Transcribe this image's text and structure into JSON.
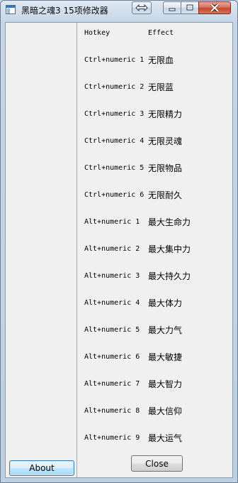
{
  "window": {
    "title": "黑暗之魂3 15项修改器",
    "caption_buttons": {
      "swap_icon": "swap-arrows-icon",
      "minimize_icon": "minimize-icon",
      "maximize_icon": "maximize-icon",
      "close_icon": "close-x-icon",
      "close_color": "#c3472f"
    }
  },
  "sidebar": {
    "about_label": "About"
  },
  "hotkeys": {
    "header": {
      "hotkey": "Hotkey",
      "effect": "Effect"
    },
    "rows": [
      {
        "hotkey": "Ctrl+numeric 1",
        "effect": "无限血"
      },
      {
        "hotkey": "Ctrl+numeric 2",
        "effect": "无限蓝"
      },
      {
        "hotkey": "Ctrl+numeric 3",
        "effect": "无限精力"
      },
      {
        "hotkey": "Ctrl+numeric 4",
        "effect": "无限灵魂"
      },
      {
        "hotkey": "Ctrl+numeric 5",
        "effect": "无限物品"
      },
      {
        "hotkey": "Ctrl+numeric 6",
        "effect": "无限耐久"
      },
      {
        "hotkey": "Alt+numeric 1",
        "effect": "最大生命力"
      },
      {
        "hotkey": "Alt+numeric 2",
        "effect": "最大集中力"
      },
      {
        "hotkey": "Alt+numeric 3",
        "effect": "最大持久力"
      },
      {
        "hotkey": "Alt+numeric 4",
        "effect": "最大体力"
      },
      {
        "hotkey": "Alt+numeric 5",
        "effect": "最大力气"
      },
      {
        "hotkey": "Alt+numeric 6",
        "effect": "最大敏捷"
      },
      {
        "hotkey": "Alt+numeric 7",
        "effect": "最大智力"
      },
      {
        "hotkey": "Alt+numeric 8",
        "effect": "最大信仰"
      },
      {
        "hotkey": "Alt+numeric 9",
        "effect": "最大运气"
      }
    ]
  },
  "footer": {
    "close_label": "Close"
  }
}
